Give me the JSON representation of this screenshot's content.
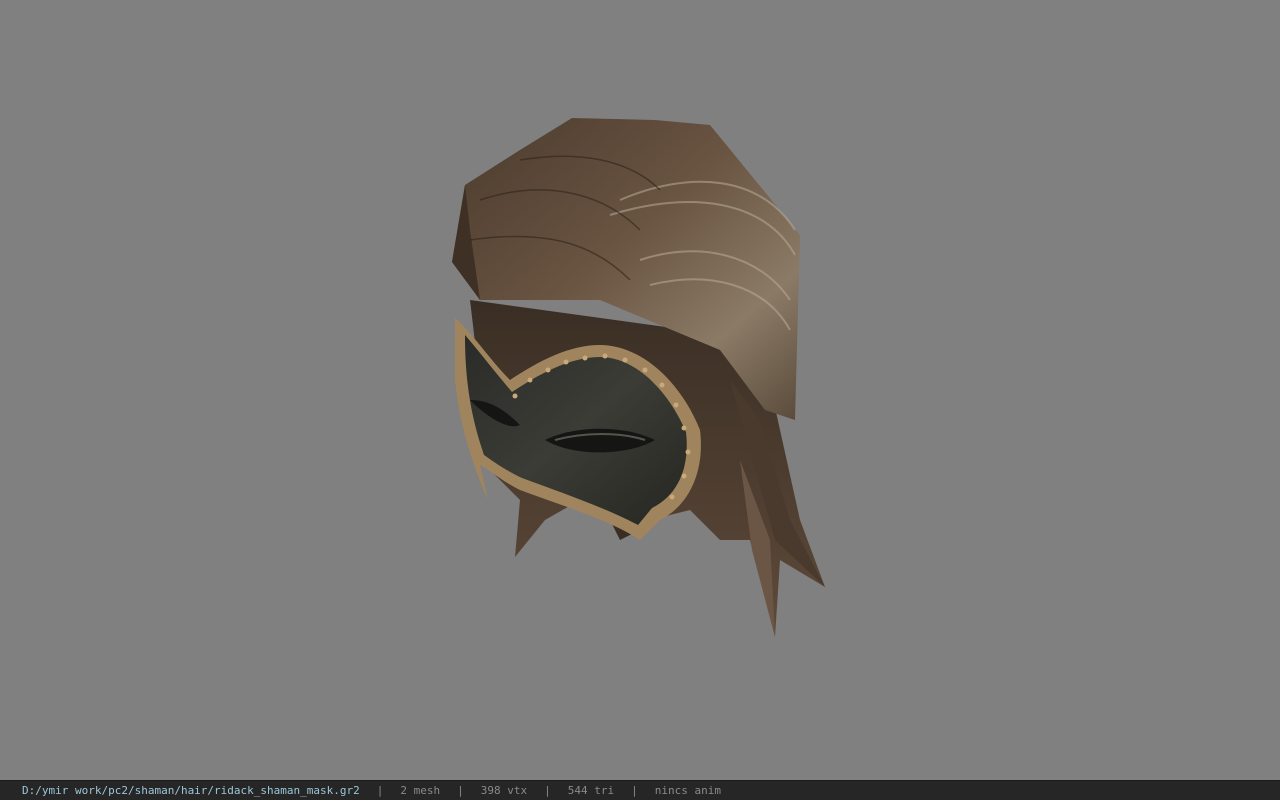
{
  "viewer": {
    "background_color": "#808080",
    "model": {
      "name": "ridack_shaman_mask",
      "object": "hair-with-mask-model"
    }
  },
  "status_bar": {
    "path": "D:/ymir work/pc2/shaman/hair/ridack_shaman_mask.gr2",
    "separator": "|",
    "mesh": "2 mesh",
    "vertices": "398 vtx",
    "triangles": "544 tri",
    "anim": "nincs anim",
    "path_color": "#9cc6d8",
    "text_color": "#8a8a8a"
  }
}
